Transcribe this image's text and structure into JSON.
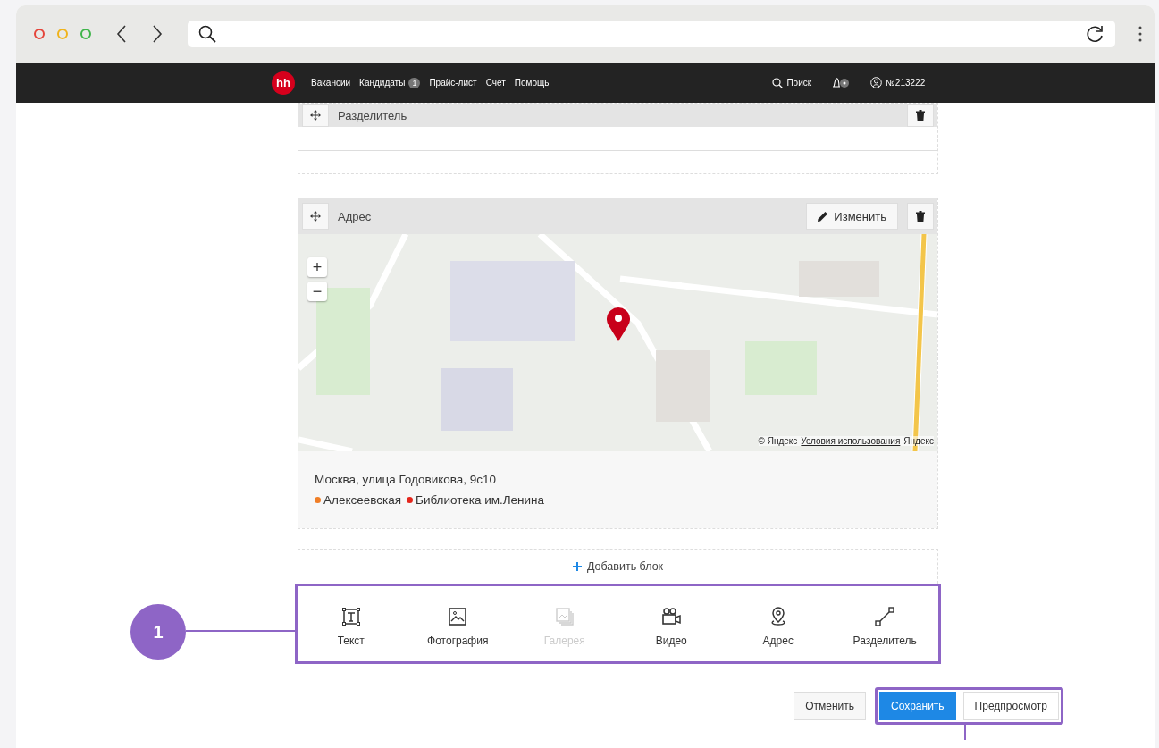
{
  "header": {
    "logo": "hh",
    "nav": [
      {
        "label": "Вакансии"
      },
      {
        "label": "Кандидаты",
        "badge": "1"
      },
      {
        "label": "Прайс-лист"
      },
      {
        "label": "Счет"
      },
      {
        "label": "Помощь"
      }
    ],
    "search": "Поиск",
    "account": "№213222"
  },
  "blocks": [
    {
      "kind": "divider",
      "title": "Разделитель"
    },
    {
      "kind": "address",
      "title": "Адрес",
      "edit_button": "Изменить",
      "map": {
        "zoom_in": "+",
        "zoom_out": "−",
        "attribution": "© Яндекс",
        "terms": "Условия использования",
        "brand": "Яндекс"
      },
      "address": "Москва, улица Годовикова, 9с10",
      "metro": [
        {
          "name": "Алексеевская",
          "color": "#f07e26"
        },
        {
          "name": "Библиотека им.Ленина",
          "color": "#e4261c"
        }
      ]
    }
  ],
  "add_block": "Добавить блок",
  "block_types": [
    {
      "kind": "text",
      "label": "Текст",
      "disabled": false
    },
    {
      "kind": "photo",
      "label": "Фотография",
      "disabled": false
    },
    {
      "kind": "gallery",
      "label": "Галерея",
      "disabled": true
    },
    {
      "kind": "video",
      "label": "Видео",
      "disabled": false
    },
    {
      "kind": "address",
      "label": "Адрес",
      "disabled": false
    },
    {
      "kind": "divider",
      "label": "Разделитель",
      "disabled": false
    }
  ],
  "callout": "1",
  "actions": {
    "cancel": "Отменить",
    "save": "Сохранить",
    "preview": "Предпросмотр"
  }
}
